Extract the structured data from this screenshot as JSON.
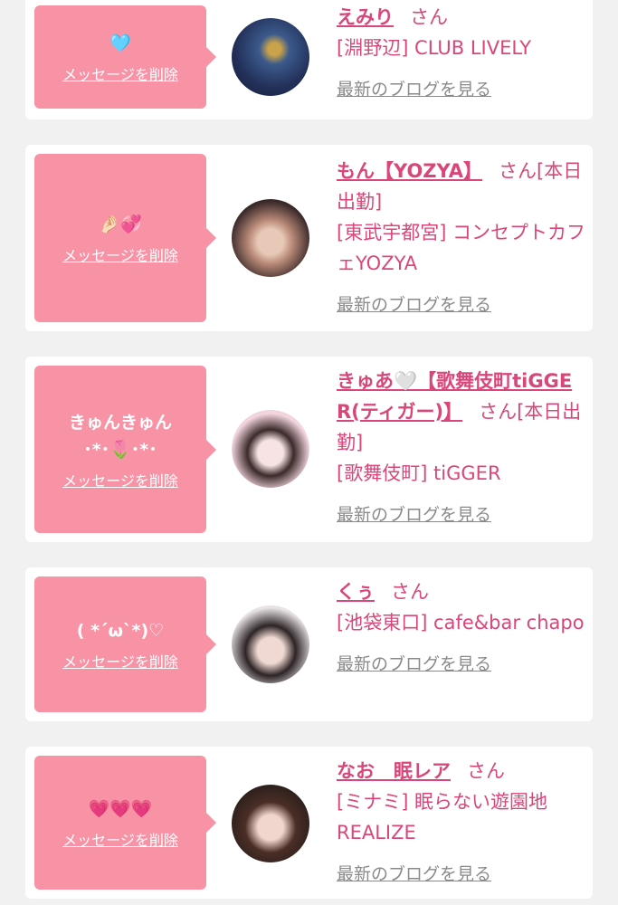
{
  "messages": [
    {
      "text": "🩵",
      "delete_label": "メッセージを削除",
      "name": "えみり",
      "honorific": "さん",
      "shop": "[淵野辺] CLUB LIVELY",
      "blog_label": "最新のブログを見る",
      "avatar_colors": [
        "#23315a",
        "#3b5a8c",
        "#c9a24a"
      ]
    },
    {
      "text": "🤌🏻💞",
      "delete_label": "メッセージを削除",
      "name": "もん【YOZYA】",
      "honorific": "さん[本日出勤]",
      "shop": "[東武宇都宮] コンセプトカフェYOZYA",
      "blog_label": "最新のブログを見る",
      "avatar_colors": [
        "#3a2a2a",
        "#b98a78",
        "#e8c9b8"
      ]
    },
    {
      "text": "きゅんきゅん\n･*･🌷･*･",
      "delete_label": "メッセージを削除",
      "name": "きゅあ🤍【歌舞伎町tiGGER(ティガー)】",
      "honorific": "さん[本日出勤]",
      "shop": "[歌舞伎町] tiGGER",
      "blog_label": "最新のブログを見る",
      "avatar_colors": [
        "#f3d6df",
        "#3b2a2a",
        "#f7e3e3"
      ]
    },
    {
      "text": "( *´ω`*)♡",
      "delete_label": "メッセージを削除",
      "name": "くぅ",
      "honorific": "さん",
      "shop": "[池袋東口] cafe&bar chapo",
      "blog_label": "最新のブログを見る",
      "avatar_colors": [
        "#e9e4e6",
        "#2d2426",
        "#f1d9d3"
      ]
    },
    {
      "text": "💗💗💗",
      "delete_label": "メッセージを削除",
      "name": "なお　眠レア",
      "honorific": "さん",
      "shop": "[ミナミ] 眠らない遊園地REALIZE",
      "blog_label": "最新のブログを見る",
      "avatar_colors": [
        "#4a2e26",
        "#f0d6cc",
        "#2c1f1c"
      ]
    }
  ]
}
